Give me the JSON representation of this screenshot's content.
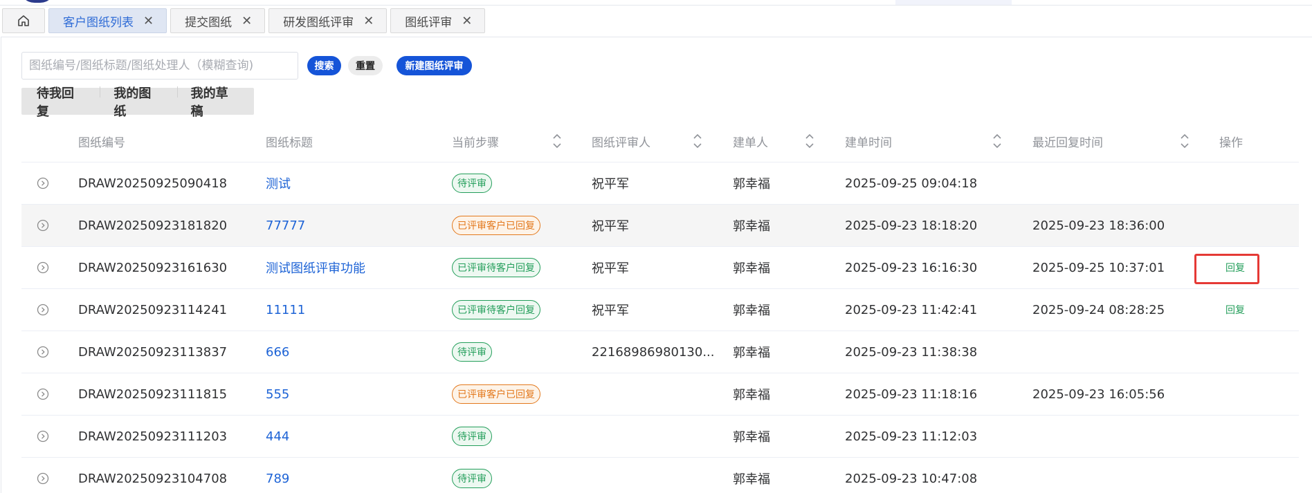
{
  "tabs": [
    {
      "label": "",
      "icon": "home-icon",
      "active": false
    },
    {
      "label": "客户图纸列表",
      "active": true
    },
    {
      "label": "提交图纸",
      "active": false
    },
    {
      "label": "研发图纸评审",
      "active": false
    },
    {
      "label": "图纸评审",
      "active": false
    }
  ],
  "close_glyph": "✕",
  "search": {
    "placeholder": "图纸编号/图纸标题/图纸处理人（模糊查询)",
    "value": "",
    "search_label": "搜索",
    "reset_label": "重置",
    "new_label": "新建图纸评审"
  },
  "subtabs": [
    "待我回复",
    "我的图纸",
    "我的草稿"
  ],
  "table": {
    "headers": {
      "code": "图纸编号",
      "title": "图纸标题",
      "step": "当前步骤",
      "reviewer": "图纸评审人",
      "creator": "建单人",
      "created": "建单时间",
      "replied": "最近回复时间",
      "action": "操作"
    },
    "rows": [
      {
        "code": "DRAW20250925090418",
        "title": "测试",
        "step": "待评审",
        "step_color": "green",
        "reviewer": "祝平军",
        "creator": "郭幸福",
        "created": "2025-09-25 09:04:18",
        "replied": "",
        "action": ""
      },
      {
        "code": "DRAW20250923181820",
        "title": "77777",
        "step": "已评审客户已回复",
        "step_color": "orange",
        "reviewer": "祝平军",
        "creator": "郭幸福",
        "created": "2025-09-23 18:18:20",
        "replied": "2025-09-23 18:36:00",
        "action": "",
        "highlight": true
      },
      {
        "code": "DRAW20250923161630",
        "title": "测试图纸评审功能",
        "step": "已评审待客户回复",
        "step_color": "green",
        "reviewer": "祝平军",
        "creator": "郭幸福",
        "created": "2025-09-23 16:16:30",
        "replied": "2025-09-25 10:37:01",
        "action": "回复",
        "boxed": true
      },
      {
        "code": "DRAW20250923114241",
        "title": "11111",
        "step": "已评审待客户回复",
        "step_color": "green",
        "reviewer": "祝平军",
        "creator": "郭幸福",
        "created": "2025-09-23 11:42:41",
        "replied": "2025-09-24 08:28:25",
        "action": "回复"
      },
      {
        "code": "DRAW20250923113837",
        "title": "666",
        "step": "待评审",
        "step_color": "green",
        "reviewer": "22168986980130...",
        "creator": "郭幸福",
        "created": "2025-09-23 11:38:38",
        "replied": "",
        "action": ""
      },
      {
        "code": "DRAW20250923111815",
        "title": "555",
        "step": "已评审客户已回复",
        "step_color": "orange",
        "reviewer": "",
        "creator": "郭幸福",
        "created": "2025-09-23 11:18:16",
        "replied": "2025-09-23 16:05:56",
        "action": ""
      },
      {
        "code": "DRAW20250923111203",
        "title": "444",
        "step": "待评审",
        "step_color": "green",
        "reviewer": "",
        "creator": "郭幸福",
        "created": "2025-09-23 11:12:03",
        "replied": "",
        "action": ""
      },
      {
        "code": "DRAW20250923104708",
        "title": "789",
        "step": "待评审",
        "step_color": "green",
        "reviewer": "",
        "creator": "郭幸福",
        "created": "2025-09-23 10:47:08",
        "replied": "",
        "action": ""
      }
    ]
  },
  "colors": {
    "primary": "#1554d8",
    "link": "#1d63d6",
    "tag_green": "#239e5a",
    "tag_orange": "#e3781c",
    "highlight_box": "#e53935"
  }
}
